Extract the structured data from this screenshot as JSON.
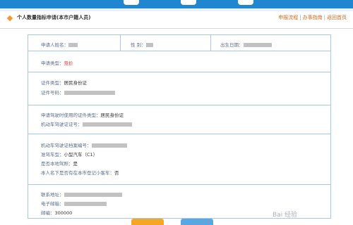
{
  "header": {
    "title": "个人数量指标申请(本市户籍人员)",
    "links": [
      "申报流程",
      "办事指南",
      "返回首页"
    ]
  },
  "form": {
    "name_label": "申请人姓名：",
    "gender_label": "性  别：",
    "birth_label": "出生日期：",
    "apply_type_label": "申请类型：",
    "apply_type_value": "竞价",
    "id_type_label": "证件类型：",
    "id_type_value": "居民身份证",
    "id_number_label": "证件号码：",
    "license_id_type_label": "申请驾驶时使用的证件类型：",
    "license_id_type_value": "居民身份证",
    "license_number_label": "机动车驾驶证证号：",
    "license_file_label": "机动车驾驶证档案编号：",
    "vehicle_type_label": "准驾车型：",
    "vehicle_type_value": "小型汽车（C1）",
    "local_license_label": "是否本地驾照：",
    "local_license_value": "是",
    "registered_car_label": "本人名下是否有在本市登记小客车：",
    "registered_car_value": "否",
    "address_label": "联系地址：",
    "email_label": "电子邮箱：",
    "postcode_label": "邮编：",
    "postcode_value": "300000"
  },
  "watermark": "Bai 经验",
  "colors": {
    "accent": "#1f86cf",
    "border": "#a6c8e3",
    "link": "#d2691e",
    "highlight": "#d32c2c"
  }
}
